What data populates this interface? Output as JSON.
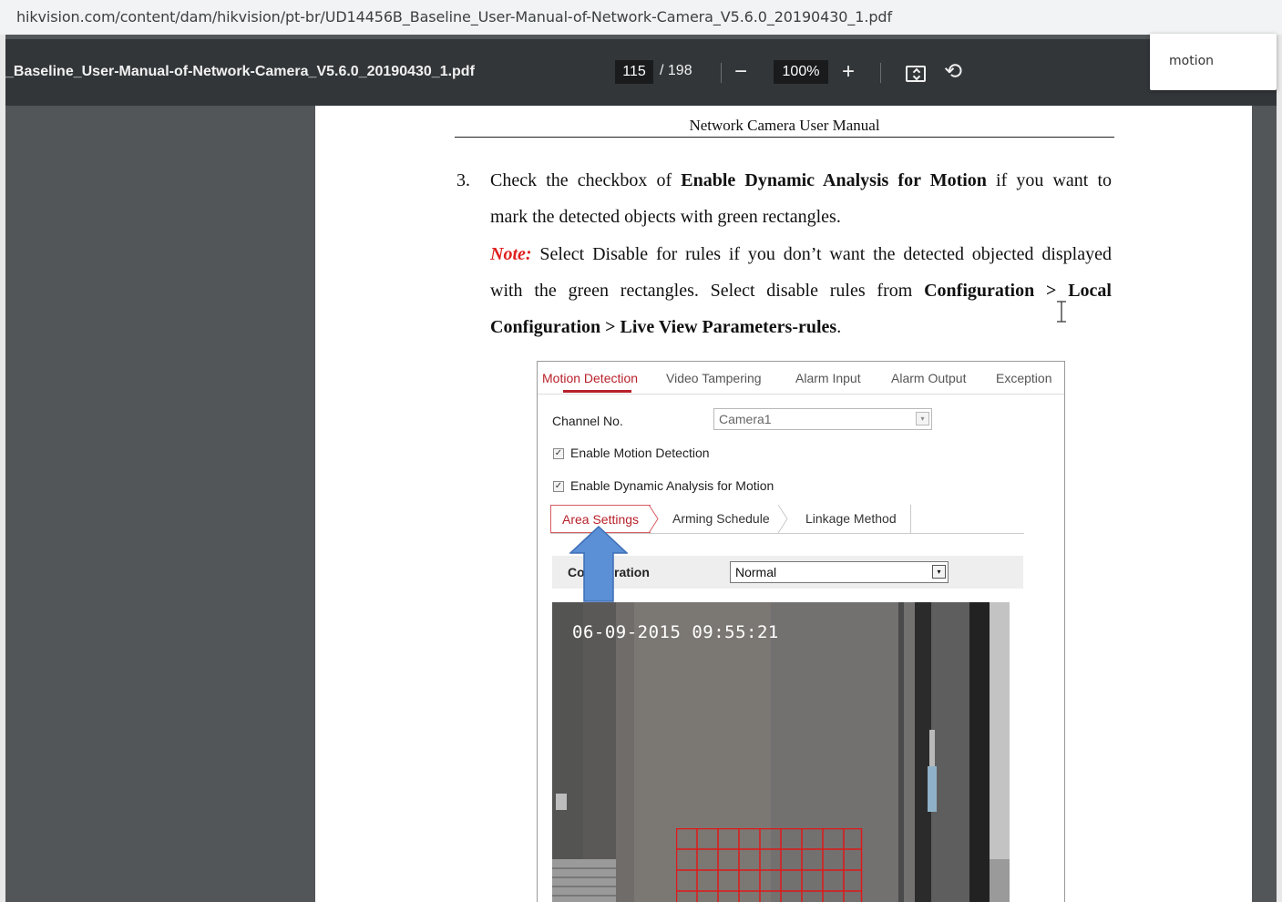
{
  "browser": {
    "url": "hikvision.com/content/dam/hikvision/pt-br/UD14456B_Baseline_User-Manual-of-Network-Camera_V5.6.0_20190430_1.pdf"
  },
  "viewer": {
    "filename": "_Baseline_User-Manual-of-Network-Camera_V5.6.0_20190430_1.pdf",
    "current_page": "115",
    "total_pages": "/ 198",
    "zoom": "100%",
    "zoom_out_glyph": "−",
    "zoom_in_glyph": "+",
    "rotate_glyph": "⟲"
  },
  "find": {
    "query": "motion"
  },
  "document": {
    "header": "Network Camera User Manual",
    "step_number": "3.",
    "line1_a": "Check the checkbox of ",
    "line1_b": "Enable Dynamic Analysis for Motion",
    "line1_c": " if you want to",
    "line2": "mark the detected objects with green rectangles.",
    "note_label": "Note:",
    "line3": " Select Disable for rules if you don’t want the detected objected displayed",
    "line4_a": "with the green rectangles. Select disable rules from ",
    "line4_b": "Configuration > Local",
    "line5_b": "Configuration > Live View Parameters-rules",
    "line5_c": "."
  },
  "screenshot": {
    "tabs": [
      "Motion Detection",
      "Video Tampering",
      "Alarm Input",
      "Alarm Output",
      "Exception"
    ],
    "channel_label": "Channel No.",
    "channel_value": "Camera1",
    "enable_motion": "Enable Motion Detection",
    "enable_dynamic": "Enable Dynamic Analysis for Motion",
    "checkmark": "✓",
    "subtabs": [
      "Area Settings",
      "Arming Schedule",
      "Linkage Method"
    ],
    "config_label_a": "Co",
    "config_label_b": "ration",
    "config_value": "Normal",
    "dropdown_glyph": "▾",
    "timestamp": "06-09-2015 09:55:21"
  },
  "colors": {
    "accent_red": "#b8212a",
    "arrow_blue": "#5b8fd6",
    "grid_red": "#e01818"
  }
}
